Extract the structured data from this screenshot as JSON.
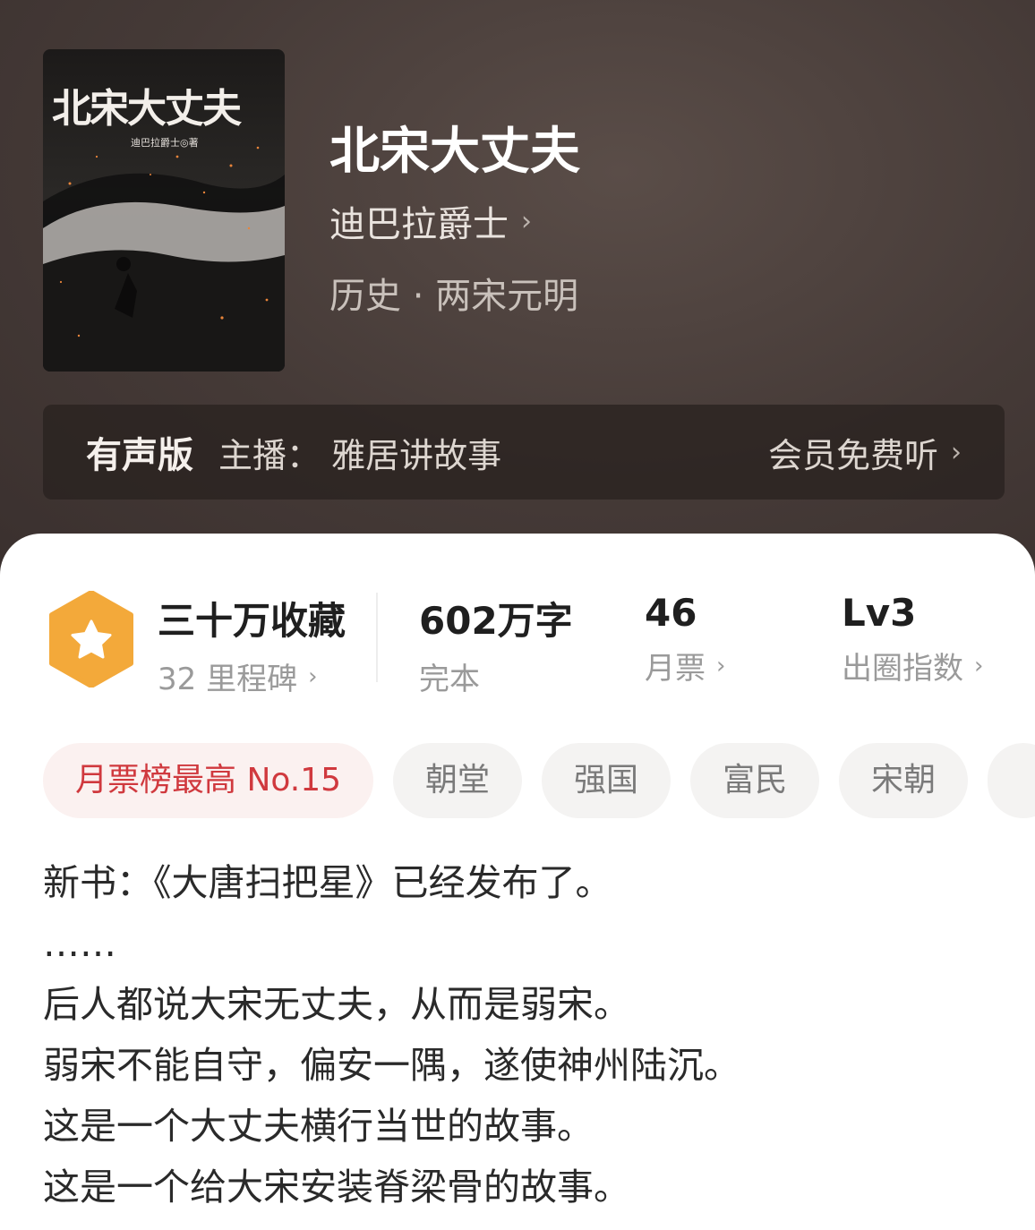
{
  "book": {
    "cover_title": "北宋大丈夫",
    "cover_author": "迪巴拉爵士◎著",
    "title": "北宋大丈夫",
    "author": "迪巴拉爵士",
    "author_chevron": "›",
    "genre": "历史 · 两宋元明"
  },
  "audio": {
    "label": "有声版",
    "host": "主播：  雅居讲故事",
    "member_action": "会员免费听",
    "chevron": "›"
  },
  "stats": {
    "badge_icon": "star-hexagon-icon",
    "favorites": "三十万收藏",
    "milestones": "32 里程碑",
    "words": "602万字",
    "status": "完本",
    "monthly_votes": "46",
    "monthly_votes_label": "月票",
    "level": "Lv3",
    "level_label": "出圈指数",
    "chevron": "›"
  },
  "tags": [
    "月票榜最高 No.15",
    "朝堂",
    "强国",
    "富民",
    "宋朝",
    ""
  ],
  "description": [
    "新书：《大唐扫把星》已经发布了。",
    "……",
    "后人都说大宋无丈夫，从而是弱宋。",
    "弱宋不能自守，偏安一隅，遂使神州陆沉。",
    "这是一个大丈夫横行当世的故事。",
    "这是一个给大宋安装脊梁骨的故事。"
  ],
  "colors": {
    "hero_bg": "#453a37",
    "badge_orange": "#f3a93a",
    "hot_tag_text": "#d0393e"
  }
}
